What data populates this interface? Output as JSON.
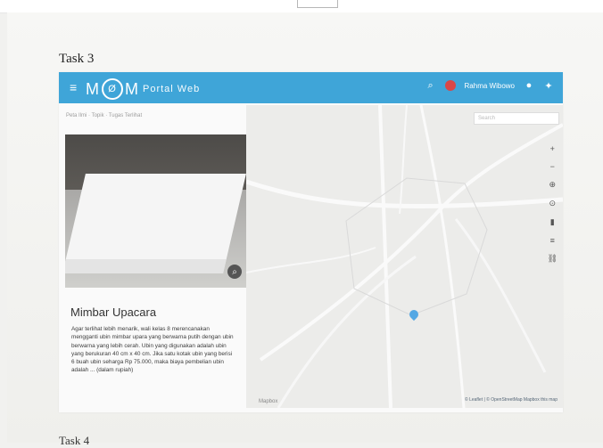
{
  "page": {
    "task_top": "Task 3",
    "task_bottom": "Task 4"
  },
  "app": {
    "brand_mark": "M",
    "brand_badge": "Ø",
    "brand_mark_right": "M",
    "brand_sub": "Portal Web",
    "username": "Rahma Wibowo",
    "menu_icon": "hamburger-icon",
    "search_icon": "search-icon",
    "user_icon": "user-icon",
    "settings_icon": "settings-icon"
  },
  "content": {
    "breadcrumb": "Peta Ilmi · Topik · Tugas Terlihat",
    "title": "Mimbar Upacara",
    "description": "Agar terlihat lebih menarik, wali kelas 8 merencanakan mengganti ubin mimbar upara yang berwarna putih dengan ubin berwarna yang lebih cerah. Ubin yang digunakan adalah ubin yang berukuran 40 cm x 40 cm. Jika satu kotak ubin yang berisi 6 buah ubin seharga Rp 75.000, maka biaya pembelian ubin adalah ... (dalam rupiah)"
  },
  "map": {
    "search_placeholder": "Search",
    "attribution": "© Leaflet | © OpenStreetMap Mapbox this map",
    "logo": "Mapbox",
    "controls": [
      "+",
      "−",
      "⊕",
      "⊙",
      "▮",
      "≡",
      "⛓"
    ]
  }
}
